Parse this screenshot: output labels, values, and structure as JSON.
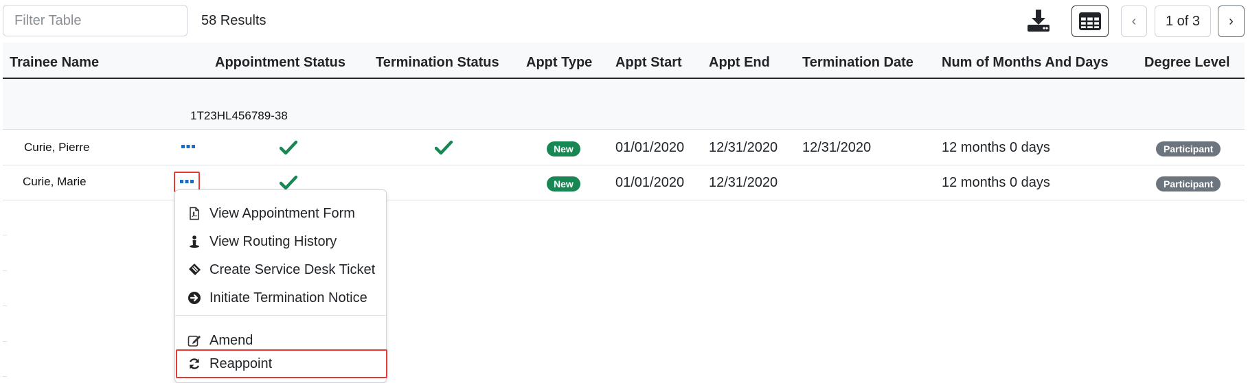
{
  "toolbar": {
    "filter_placeholder": "Filter Table",
    "results_text": "58 Results",
    "download_icon": "download-icon",
    "grid_icon": "table-grid-icon",
    "pager_prev": "‹",
    "pager_page": "1 of 3",
    "pager_next": "›"
  },
  "table": {
    "columns": [
      "Trainee Name",
      "Appointment Status",
      "Termination Status",
      "Appt Type",
      "Appt Start",
      "Appt End",
      "Termination Date",
      "Num of Months And Days",
      "Degree Level"
    ],
    "group_label": "1T23HL456789-38",
    "rows": [
      {
        "name": "Curie, Pierre",
        "appt_type": "New",
        "appt_start": "01/01/2020",
        "appt_end": "12/31/2020",
        "termination_date": "12/31/2020",
        "months_days": "12 months 0 days",
        "degree_level": "Participant",
        "appointment_status": "check-icon",
        "termination_status": "check-icon"
      },
      {
        "name": "Curie, Marie",
        "appt_type": "New",
        "appt_start": "01/01/2020",
        "appt_end": "12/31/2020",
        "termination_date": "",
        "months_days": "12 months 0 days",
        "degree_level": "Participant",
        "appointment_status": "check-icon",
        "termination_status": ""
      }
    ]
  },
  "menu": {
    "items": [
      {
        "label": "View Appointment Form",
        "icon": "pdf-file-icon"
      },
      {
        "label": "View Routing History",
        "icon": "person-route-icon"
      },
      {
        "label": "Create Service Desk Ticket",
        "icon": "ticket-icon"
      },
      {
        "label": "Initiate Termination Notice",
        "icon": "arrow-circle-right-icon"
      },
      {
        "label": "Amend",
        "icon": "edit-icon"
      },
      {
        "label": "Reappoint",
        "icon": "refresh-icon"
      }
    ]
  },
  "colors": {
    "accent_blue": "#1a6fc4",
    "check_green": "#198754",
    "badge_green": "#198754",
    "badge_gray": "#6c757d",
    "highlight_red": "#e53935"
  }
}
